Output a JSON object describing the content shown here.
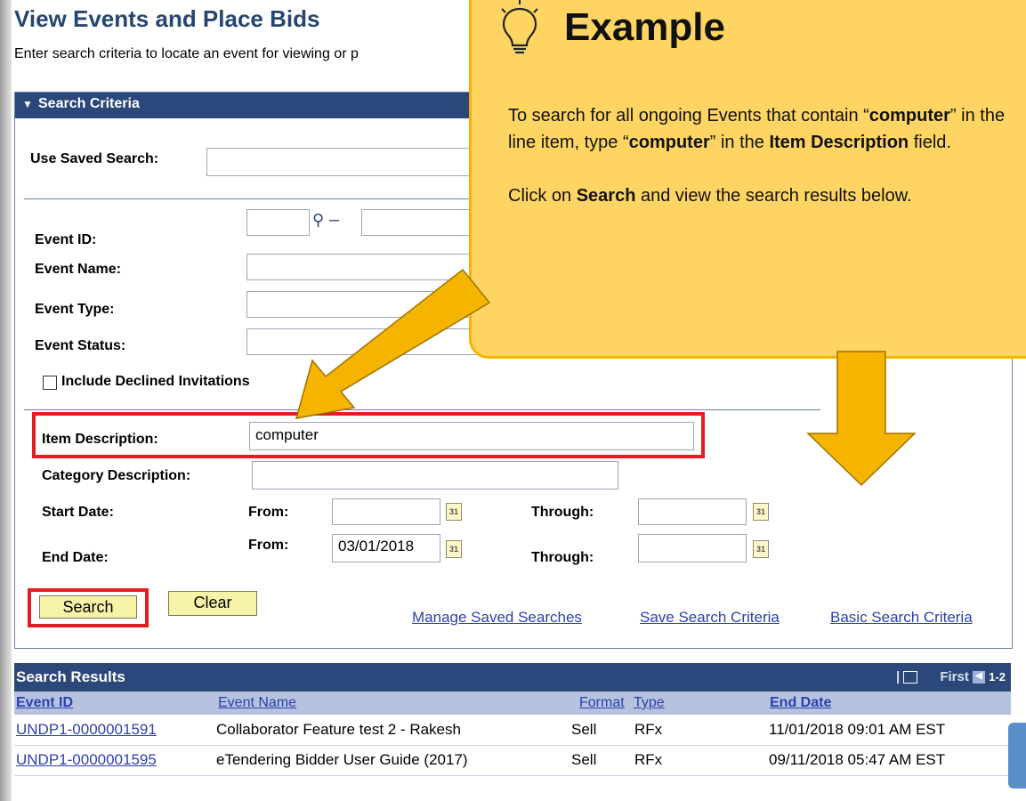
{
  "page": {
    "title": "View Events and Place Bids",
    "instructions": "Enter search criteria to locate an event for viewing or p"
  },
  "search_criteria": {
    "header": "Search Criteria",
    "use_saved_search_label": "Use Saved Search:",
    "use_saved_search_value": "",
    "event_id_label": "Event ID:",
    "event_id_value": "",
    "event_id_range_dash": "–",
    "event_name_label": "Event Name:",
    "event_type_label": "Event Type:",
    "event_status_label": "Event Status:",
    "include_declined_label": "Include Declined Invitations",
    "include_declined_checked": false,
    "item_description_label": "Item Description:",
    "item_description_value": "computer",
    "category_description_label": "Category Description:",
    "category_description_value": "",
    "start_date_label": "Start Date:",
    "end_date_label": "End Date:",
    "from_label": "From:",
    "through_label": "Through:",
    "start_from_value": "",
    "start_through_value": "",
    "end_from_value": "03/01/2018",
    "end_through_value": "",
    "calendar_icon_text": "31",
    "search_button": "Search",
    "clear_button": "Clear",
    "links": {
      "manage_saved": "Manage Saved Searches",
      "save_criteria": "Save Search Criteria",
      "basic_criteria": "Basic Search Criteria"
    }
  },
  "search_results": {
    "header": "Search Results",
    "nav_first": "First",
    "nav_range": "1-2",
    "columns": [
      "Event ID",
      "Event Name",
      "Format",
      "Type",
      "End Date"
    ],
    "rows": [
      {
        "event_id": "UNDP1-0000001591",
        "event_name": "Collaborator Feature test 2 - Rakesh",
        "format": "Sell",
        "type": "RFx",
        "end_date": "11/01/2018 09:01 AM EST"
      },
      {
        "event_id": "UNDP1-0000001595",
        "event_name": "eTendering Bidder User Guide (2017)",
        "format": "Sell",
        "type": "RFx",
        "end_date": "09/11/2018 05:47 AM EST"
      }
    ]
  },
  "callout": {
    "title": "Example",
    "p1_a": "To search for all ongoing Events that contain “",
    "p1_b": "computer",
    "p1_c": "” in the line item, type “",
    "p1_d": "computer",
    "p1_e": "” in the ",
    "p1_f": "Item Description",
    "p1_g": " field.",
    "p2_a": "Click on ",
    "p2_b": "Search",
    "p2_c": " and view the search results below."
  },
  "colors": {
    "header_blue": "#2c4779",
    "title_blue": "#27466f",
    "callout_fill": "#fed563",
    "callout_border": "#f6b400",
    "highlight_red": "#e31d23",
    "button_yellow": "#f7f3a8",
    "link_blue": "#2c3fb0"
  },
  "icons": [
    "lightbulb-icon",
    "dropdown-arrow-icon",
    "magnifier-icon",
    "calendar-icon",
    "arrow-annotation",
    "un-emblem-icon"
  ]
}
